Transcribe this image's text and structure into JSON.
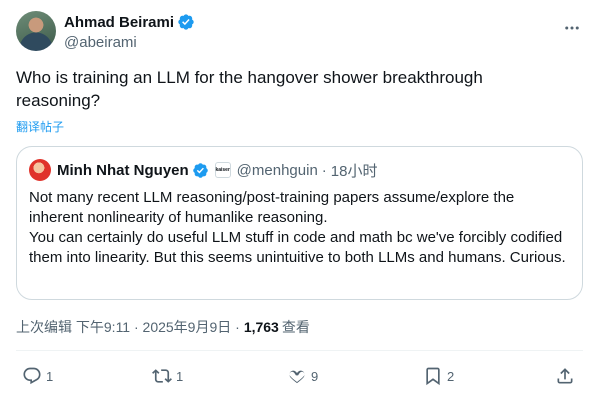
{
  "author": {
    "display_name": "Ahmad Beirami",
    "handle": "@abeirami",
    "verified": true
  },
  "tweet": {
    "text": "Who is training an LLM for the hangover shower breakthrough reasoning?",
    "translate_label": "翻译帖子"
  },
  "quote": {
    "display_name": "Minh Nhat Nguyen",
    "verified": true,
    "badge_text": "kaiser",
    "handle": "@menhguin",
    "separator": "·",
    "time": "18小时",
    "text_line1": "Not many recent LLM reasoning/post-training papers assume/explore the inherent nonlinearity of humanlike reasoning.",
    "text_line2": "You can certainly do useful LLM stuff in code and math bc we've forcibly codified them into linearity. But this seems unintuitive to both LLMs and humans. Curious."
  },
  "meta": {
    "timestamp": "上次编辑 下午9:11 · 2025年9月9日 · ",
    "views_count": "1,763",
    "views_label": "查看"
  },
  "actions": {
    "reply_count": "1",
    "retweet_count": "1",
    "like_count": "9",
    "bookmark_count": "2"
  },
  "colors": {
    "accent": "#1d9bf0",
    "text_primary": "#0f1419",
    "text_secondary": "#536471",
    "border": "#cfd9de"
  },
  "icons": [
    "verified-badge-icon",
    "more-icon",
    "reply-icon",
    "retweet-icon",
    "like-icon",
    "bookmark-icon",
    "share-icon"
  ]
}
